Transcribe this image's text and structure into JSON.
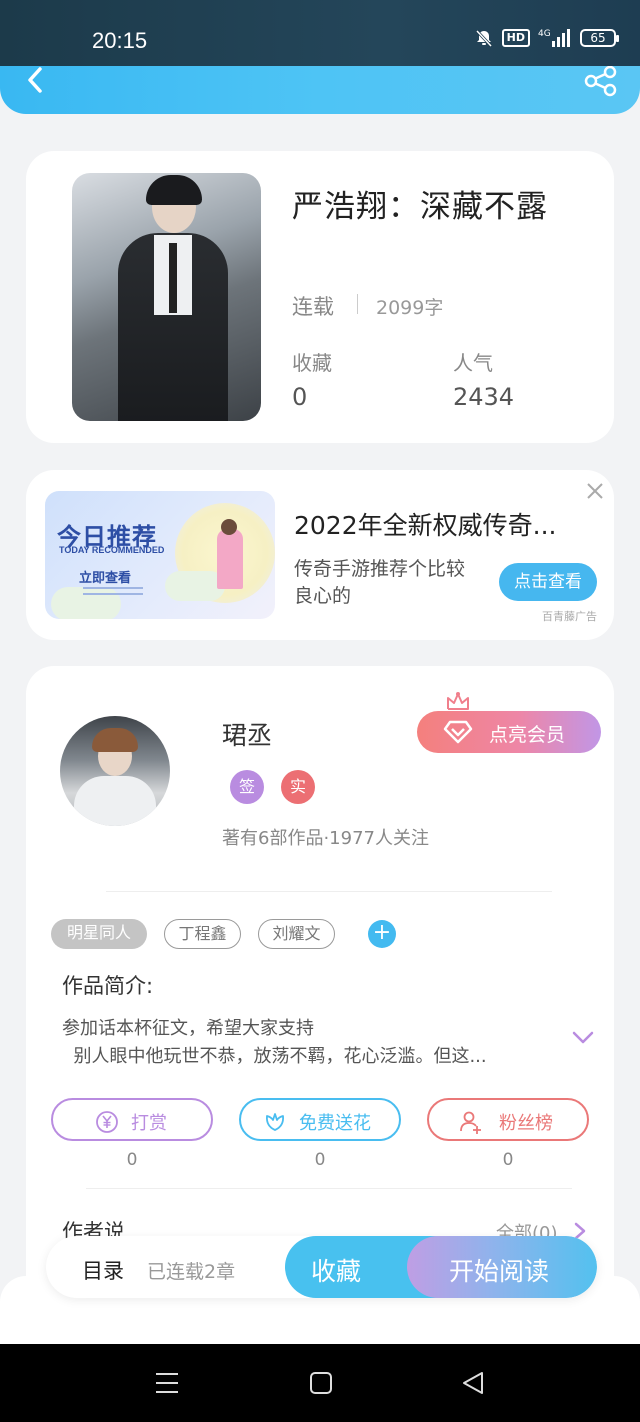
{
  "status_bar": {
    "time": "20:15",
    "hd_label": "HD",
    "network_label": "4G",
    "battery": "65"
  },
  "header": {
    "back_icon": "chevron-left-icon",
    "share_icon": "share-icon"
  },
  "book": {
    "title": "严浩翔：深藏不露",
    "status": "连载",
    "word_count": "2099字",
    "favorites_label": "收藏",
    "favorites_value": "0",
    "popularity_label": "人气",
    "popularity_value": "2434"
  },
  "ad": {
    "image_title": "今日推荐",
    "image_subtitle": "TODAY RECOMMENDED",
    "image_cta": "立即查看",
    "title": "2022年全新权威传奇...",
    "description": "传奇手游推荐个比较良心的",
    "button_label": "点击查看",
    "source": "百青藤广告"
  },
  "author": {
    "name": "珺丞",
    "vip_button": "点亮会员",
    "badge_signed": "签",
    "badge_verified": "实",
    "stats": "著有6部作品·1977人关注",
    "tags": [
      "明星同人",
      "丁程鑫",
      "刘耀文"
    ],
    "intro_title": "作品简介:",
    "intro_line1": "参加话本杯征文，希望大家支持",
    "intro_line2": "别人眼中他玩世不恭，放荡不羁，花心泛滥。但这...",
    "actions": [
      {
        "label": "打赏",
        "count": "0",
        "icon": "yen-icon",
        "color": "#b98ce0"
      },
      {
        "label": "免费送花",
        "count": "0",
        "icon": "flower-icon",
        "color": "#49bdf0"
      },
      {
        "label": "粉丝榜",
        "count": "0",
        "icon": "user-icon",
        "color": "#ea7878"
      }
    ],
    "author_says": "作者说",
    "all_link": "全部(0)"
  },
  "bottom_bar": {
    "toc_label": "目录",
    "toc_status": "已连载2章",
    "favorite_label": "收藏",
    "read_label": "开始阅读"
  },
  "colors": {
    "accent_blue": "#46b7ef",
    "vip_pink": "#f07f8c",
    "badge_purple": "#b98ce0",
    "badge_red": "#ec6f73"
  }
}
